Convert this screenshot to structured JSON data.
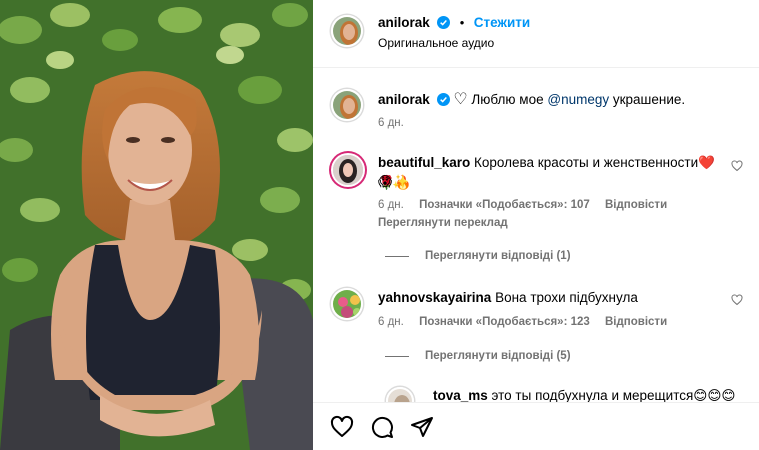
{
  "post": {
    "username": "anilorak",
    "follow_label": "Стежити",
    "audio_label": "Оригинальное аудио",
    "caption": {
      "username": "anilorak",
      "emoji_prefix": "♡",
      "text_before": "Люблю мое",
      "mention": "@numegy",
      "text_after": "украшение.",
      "time": "6 дн."
    }
  },
  "comments": [
    {
      "username": "beautiful_karo",
      "text": "Королева красоты и женственности❤️🌹🔥",
      "text_line2": "😱✨",
      "time": "6 дн.",
      "likes": "Позначки «Подобається»: 107",
      "reply_label": "Відповісти",
      "translate_label": "Переглянути переклад",
      "view_replies": "Переглянути відповіді (1)"
    },
    {
      "username": "yahnovskayairina",
      "text": "Вона трохи підбухнула",
      "time": "6 дн.",
      "likes": "Позначки «Подобається»: 123",
      "reply_label": "Відповісти",
      "view_replies": "Переглянути відповіді (5)"
    }
  ],
  "reply_preview": {
    "username": "tova_ms",
    "text": "это ты подбухнула и мерещится😊😊😊"
  },
  "icons": {
    "verified": "verified-badge-icon",
    "like": "heart-icon",
    "comment": "comment-icon",
    "share": "share-icon"
  },
  "colors": {
    "accent": "#0095f6",
    "verified": "#0095f6",
    "mention": "#00376b",
    "muted": "#737373"
  }
}
